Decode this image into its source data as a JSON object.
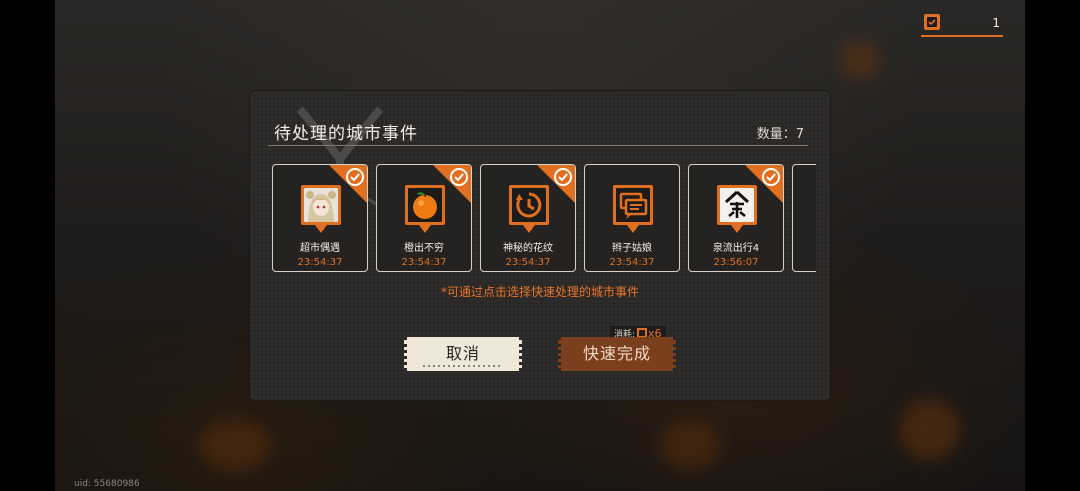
{
  "uid": "uid: 55680986",
  "ticket": {
    "icon": "ticket-check-icon",
    "value": "1"
  },
  "dialog": {
    "title": "待处理的城市事件",
    "count_label": "数量：7",
    "hint": "*可通过点击选择快速处理的城市事件",
    "cancel_label": "取消",
    "confirm_label": "快速完成",
    "cost_label": "消耗:",
    "cost_value": "x6"
  },
  "events": [
    {
      "name": "超市偶遇",
      "time": "23:54:37",
      "icon": "character-portrait-icon",
      "selected": true
    },
    {
      "name": "橙出不穷",
      "time": "23:54:37",
      "icon": "orange-icon",
      "selected": true
    },
    {
      "name": "神秘的花纹",
      "time": "23:54:37",
      "icon": "timer-icon",
      "selected": true
    },
    {
      "name": "辫子姑娘",
      "time": "23:54:37",
      "icon": "chat-bubbles-icon",
      "selected": false
    },
    {
      "name": "泉流出行4",
      "time": "23:56:07",
      "icon": "calligraphy-glyph-icon",
      "selected": true
    }
  ],
  "colors": {
    "accent": "#e0701f",
    "panel": "#2b2927"
  }
}
